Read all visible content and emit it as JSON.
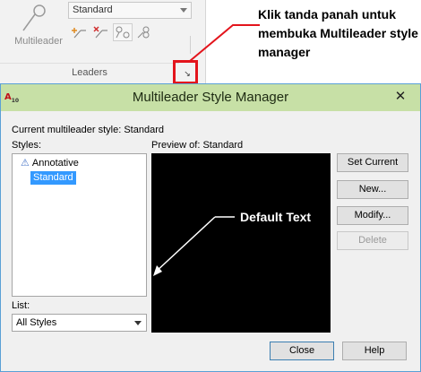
{
  "ribbon": {
    "multileader_label": "Multileader",
    "style_value": "Standard",
    "panel_title": "Leaders",
    "launcher_glyph": "↘"
  },
  "annotation": {
    "text": "Klik tanda panah untuk membuka Multileader style manager",
    "highlight_color": "#e3141c"
  },
  "dialog": {
    "title": "Multileader Style Manager",
    "app_icon_text": "A",
    "app_icon_sub": "10",
    "close_glyph": "✕",
    "current_style_label": "Current multileader style: Standard",
    "styles_label": "Styles:",
    "styles": [
      {
        "label": "Annotative",
        "icon": "annotative-icon"
      },
      {
        "label": "Standard",
        "selected": true
      }
    ],
    "list_label": "List:",
    "list_value": "All Styles",
    "preview_label": "Preview of: Standard",
    "preview_text": "Default Text",
    "buttons": {
      "set_current": "Set Current",
      "new": "New...",
      "modify": "Modify...",
      "delete": "Delete",
      "close": "Close",
      "help": "Help"
    },
    "titlebar_color": "#c7e0a6",
    "selection_color": "#3399ff"
  }
}
